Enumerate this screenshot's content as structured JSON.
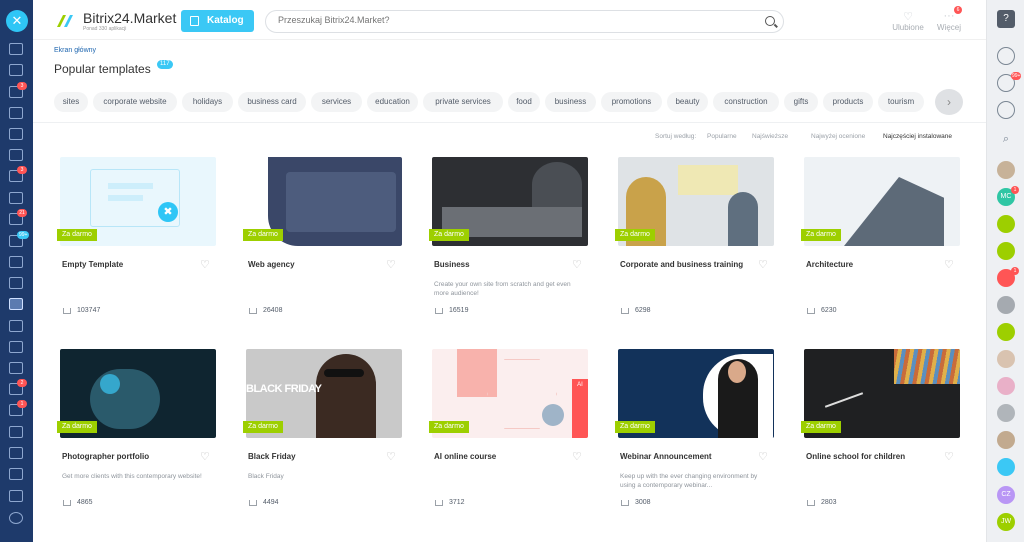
{
  "app": {
    "title": "Bitrix24.Market",
    "subtitle": "Ponad 330 aplikacji"
  },
  "header": {
    "katalog_label": "Katalog",
    "search_placeholder": "Przeszukaj Bitrix24.Market?",
    "favorites_label": "Ulubione",
    "more_label": "Więcej",
    "more_badge": "6"
  },
  "breadcrumb": "Ekran główny",
  "page_title": "Popular templates",
  "title_count": "117",
  "tags": [
    "sites",
    "corporate website",
    "holidays",
    "business card",
    "services",
    "education",
    "private services",
    "food",
    "business",
    "promotions",
    "beauty",
    "construction",
    "gifts",
    "products",
    "tourism"
  ],
  "sort": {
    "label": "Sortuj według:",
    "options": [
      "Popularne",
      "Najświeższe",
      "Najwyżej ocenione",
      "Najczęściej instalowane"
    ],
    "active_index": 3
  },
  "card_badge": "Za darmo",
  "cards": [
    {
      "name": "Empty Template",
      "desc": "",
      "installs": "103747"
    },
    {
      "name": "Web agency",
      "desc": "",
      "installs": "26408"
    },
    {
      "name": "Business",
      "desc": "Create your own site from scratch and get even more audience!",
      "installs": "16519"
    },
    {
      "name": "Corporate and business training",
      "desc": "",
      "installs": "6298"
    },
    {
      "name": "Architecture",
      "desc": "",
      "installs": "6230"
    },
    {
      "name": "Photographer portfolio",
      "desc": "Get more clients with this contemporary website!",
      "installs": "4865"
    },
    {
      "name": "Black Friday",
      "desc": "Black Friday",
      "installs": "4494",
      "image_text": "BLACK FRIDAY"
    },
    {
      "name": "AI online course",
      "desc": "",
      "installs": "3712",
      "image_text": "AI"
    },
    {
      "name": "Webinar Announcement",
      "desc": "Keep up with the ever changing environment by using a contemporary webinar...",
      "installs": "3008"
    },
    {
      "name": "Online school for children",
      "desc": "",
      "installs": "2803"
    }
  ],
  "leftbar_badges": [
    "3",
    "3",
    "21",
    "99+",
    "2",
    "1"
  ],
  "rightbar": {
    "badges": [
      "99+",
      "1",
      "1"
    ],
    "avatars": [
      "MC",
      "CZ",
      "JW"
    ]
  },
  "colors": {
    "accent": "#3bc8f5",
    "badge": "#9dcf00",
    "sidebar": "#1e3a6b"
  }
}
